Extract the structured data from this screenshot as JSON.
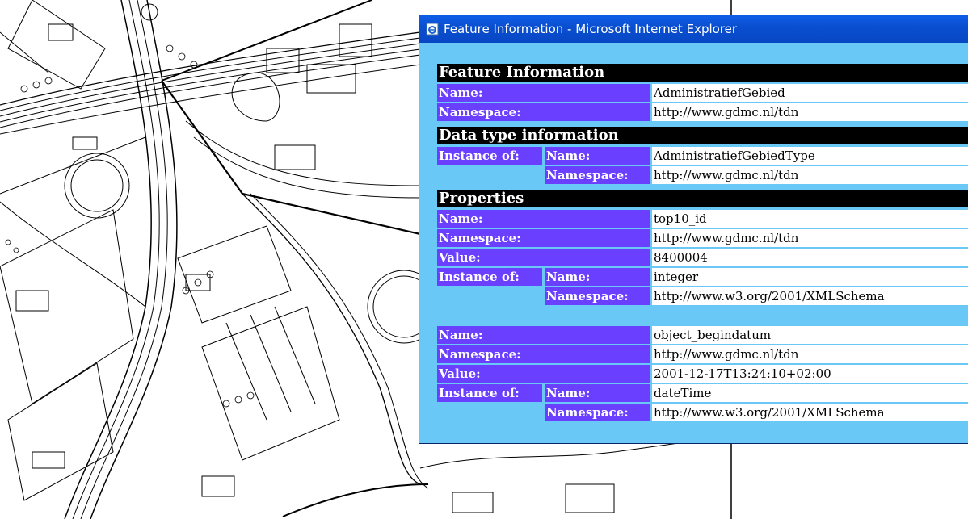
{
  "window": {
    "title": "Feature Information - Microsoft Internet Explorer"
  },
  "feature_info": {
    "heading": "Feature Information",
    "name_label": "Name:",
    "name_value": "AdministratiefGebied",
    "namespace_label": "Namespace:",
    "namespace_value": "http://www.gdmc.nl/tdn"
  },
  "data_type": {
    "heading": "Data type information",
    "instance_label": "Instance of:",
    "name_label": "Name:",
    "name_value": "AdministratiefGebiedType",
    "namespace_label": "Namespace:",
    "namespace_value": "http://www.gdmc.nl/tdn"
  },
  "properties": {
    "heading": "Properties",
    "items": [
      {
        "name_label": "Name:",
        "name_value": "top10_id",
        "namespace_label": "Namespace:",
        "namespace_value": "http://www.gdmc.nl/tdn",
        "value_label": "Value:",
        "value_value": "8400004",
        "instance_label": "Instance of:",
        "type_name_label": "Name:",
        "type_name_value": "integer",
        "type_ns_label": "Namespace:",
        "type_ns_value": "http://www.w3.org/2001/XMLSchema"
      },
      {
        "name_label": "Name:",
        "name_value": "object_begindatum",
        "namespace_label": "Namespace:",
        "namespace_value": "http://www.gdmc.nl/tdn",
        "value_label": "Value:",
        "value_value": "2001-12-17T13:24:10+02:00",
        "instance_label": "Instance of:",
        "type_name_label": "Name:",
        "type_name_value": "dateTime",
        "type_ns_label": "Namespace:",
        "type_ns_value": "http://www.w3.org/2001/XMLSchema"
      }
    ]
  },
  "colors": {
    "label_bg": "#6b3fff",
    "window_bg": "#6ac8f7",
    "titlebar": "#0a4fd1"
  }
}
